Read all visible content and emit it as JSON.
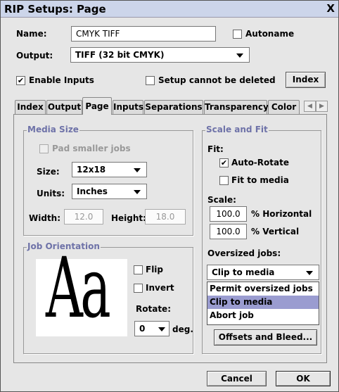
{
  "window": {
    "title": "RIP Setups: Page",
    "close_glyph": "X"
  },
  "name": {
    "label": "Name:",
    "value": "CMYK TIFF"
  },
  "autoname": {
    "label": "Autoname",
    "checked": false
  },
  "output": {
    "label": "Output:",
    "value": "TIFF (32 bit CMYK)"
  },
  "enable_inputs": {
    "label": "Enable Inputs",
    "checked": true
  },
  "setup_cannot_be_deleted": {
    "label": "Setup cannot be deleted",
    "checked": false
  },
  "index_button": "Index",
  "tabs": [
    {
      "label": "Index",
      "active": false
    },
    {
      "label": "Output",
      "active": false
    },
    {
      "label": "Page",
      "active": true
    },
    {
      "label": "Inputs",
      "active": false
    },
    {
      "label": "Separations",
      "active": false
    },
    {
      "label": "Transparency",
      "active": false
    },
    {
      "label": "Color",
      "active": false
    }
  ],
  "media_size": {
    "title": "Media Size",
    "pad_smaller_jobs": {
      "label": "Pad smaller jobs",
      "checked": false,
      "disabled": true
    },
    "size": {
      "label": "Size:",
      "value": "12x18"
    },
    "units": {
      "label": "Units:",
      "value": "Inches"
    },
    "width": {
      "label": "Width:",
      "value": "12.0"
    },
    "height": {
      "label": "Height:",
      "value": "18.0"
    }
  },
  "job_orientation": {
    "title": "Job Orientation",
    "preview_text": "Aa",
    "flip": {
      "label": "Flip",
      "checked": false
    },
    "invert": {
      "label": "Invert",
      "checked": false
    },
    "rotate": {
      "label": "Rotate:",
      "value": "0",
      "unit": "deg."
    }
  },
  "scale_fit": {
    "title": "Scale and Fit",
    "fit_label": "Fit:",
    "auto_rotate": {
      "label": "Auto-Rotate",
      "checked": true
    },
    "fit_to_media": {
      "label": "Fit to media",
      "checked": false
    },
    "scale_label": "Scale:",
    "horizontal": {
      "value": "100.0",
      "label": "% Horizontal"
    },
    "vertical": {
      "value": "100.0",
      "label": "% Vertical"
    },
    "oversized_label": "Oversized jobs:",
    "oversized_value": "Clip to media",
    "oversized_options": [
      "Permit oversized jobs",
      "Clip to media",
      "Abort job"
    ],
    "selected_option": "Clip to media",
    "offsets_button": "Offsets and Bleed..."
  },
  "footer": {
    "cancel": "Cancel",
    "ok": "OK"
  },
  "colors": {
    "titlebar": "#ccd5ea",
    "group_title": "#6e72a8",
    "selection": "#9a9cd0",
    "background": "#e6e6e6"
  }
}
